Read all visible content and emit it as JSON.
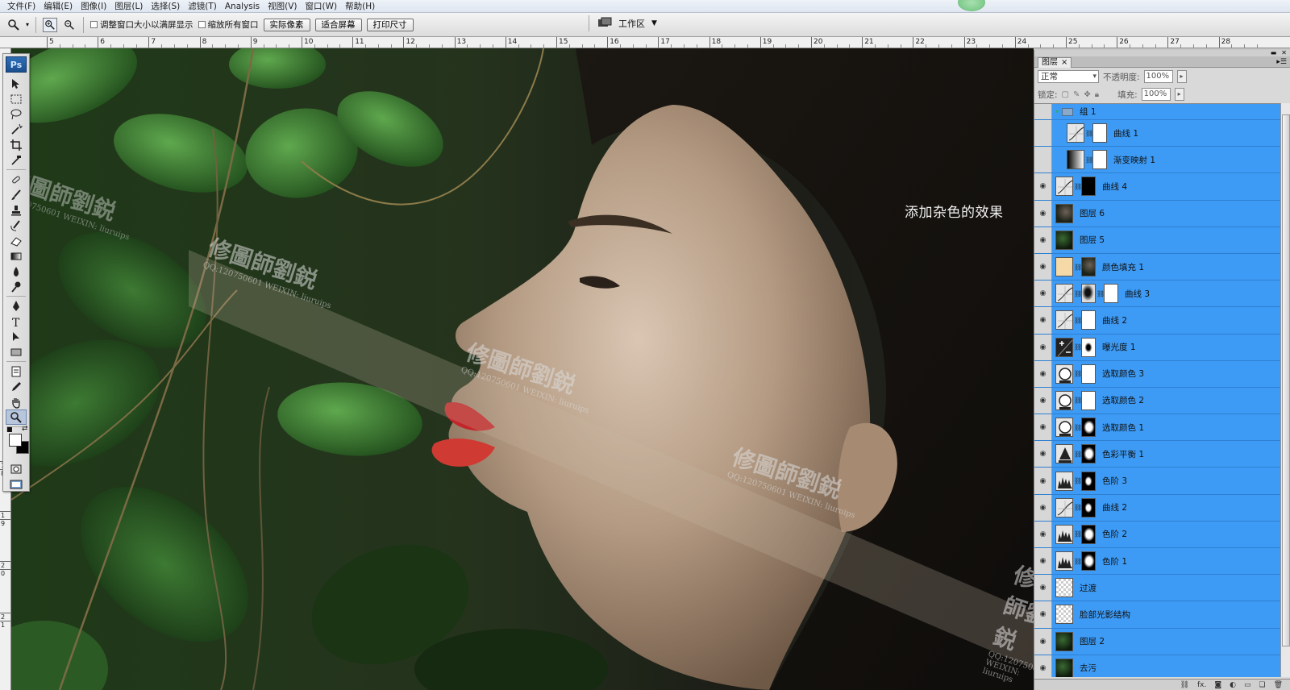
{
  "menubar": {
    "items": [
      "文件(F)",
      "编辑(E)",
      "图像(I)",
      "图层(L)",
      "选择(S)",
      "滤镜(T)",
      "Analysis",
      "视图(V)",
      "窗口(W)",
      "帮助(H)"
    ]
  },
  "options_bar": {
    "checkbox_resize": "调整窗口大小以满屏显示",
    "checkbox_zoom_all": "缩放所有窗口",
    "btn_actual_pixels": "实际像素",
    "btn_fit_screen": "适合屏幕",
    "btn_print_size": "打印尺寸",
    "workspace_label": "工作区"
  },
  "ruler": {
    "top_labels": [
      "5",
      "6",
      "7",
      "8",
      "9",
      "10",
      "11",
      "12",
      "13",
      "14",
      "15",
      "16",
      "17",
      "18",
      "19",
      "20",
      "21",
      "22",
      "23",
      "24",
      "25",
      "26",
      "27",
      "28"
    ],
    "left_labels": [
      "1",
      "8",
      "1",
      "9",
      "2",
      "0",
      "2",
      "1"
    ]
  },
  "toolbox": {
    "logo": "Ps"
  },
  "canvas": {
    "overlay_text": "添加杂色的效果",
    "watermark_title": "修圖師劉鋭",
    "watermark_sub": "QQ:120750601 WEIXIN: liuruips"
  },
  "layers_panel": {
    "tab_label": "图层",
    "tab_close": "×",
    "blend_mode": "正常",
    "opacity_label": "不透明度:",
    "opacity_value": "100%",
    "lock_label": "锁定:",
    "fill_label": "填充:",
    "fill_value": "100%",
    "layers": [
      {
        "name": "组 1",
        "kind": "group"
      },
      {
        "name": "曲线 1"
      },
      {
        "name": "渐变映射 1"
      },
      {
        "name": "曲线 4"
      },
      {
        "name": "图层 6"
      },
      {
        "name": "图层 5"
      },
      {
        "name": "颜色填充 1"
      },
      {
        "name": "曲线 3"
      },
      {
        "name": "曲线 2"
      },
      {
        "name": "曝光度 1"
      },
      {
        "name": "选取颜色 3"
      },
      {
        "name": "选取颜色 2"
      },
      {
        "name": "选取颜色 1"
      },
      {
        "name": "色彩平衡 1"
      },
      {
        "name": "色阶 3"
      },
      {
        "name": "曲线 2"
      },
      {
        "name": "色阶 2"
      },
      {
        "name": "色阶 1"
      },
      {
        "name": "过渡"
      },
      {
        "name": "脸部光影结构"
      },
      {
        "name": "图层 2"
      },
      {
        "name": "去污"
      }
    ]
  },
  "colors": {
    "layer_selected": "#3d9bf5",
    "ps_logo": "#1b4f90"
  }
}
